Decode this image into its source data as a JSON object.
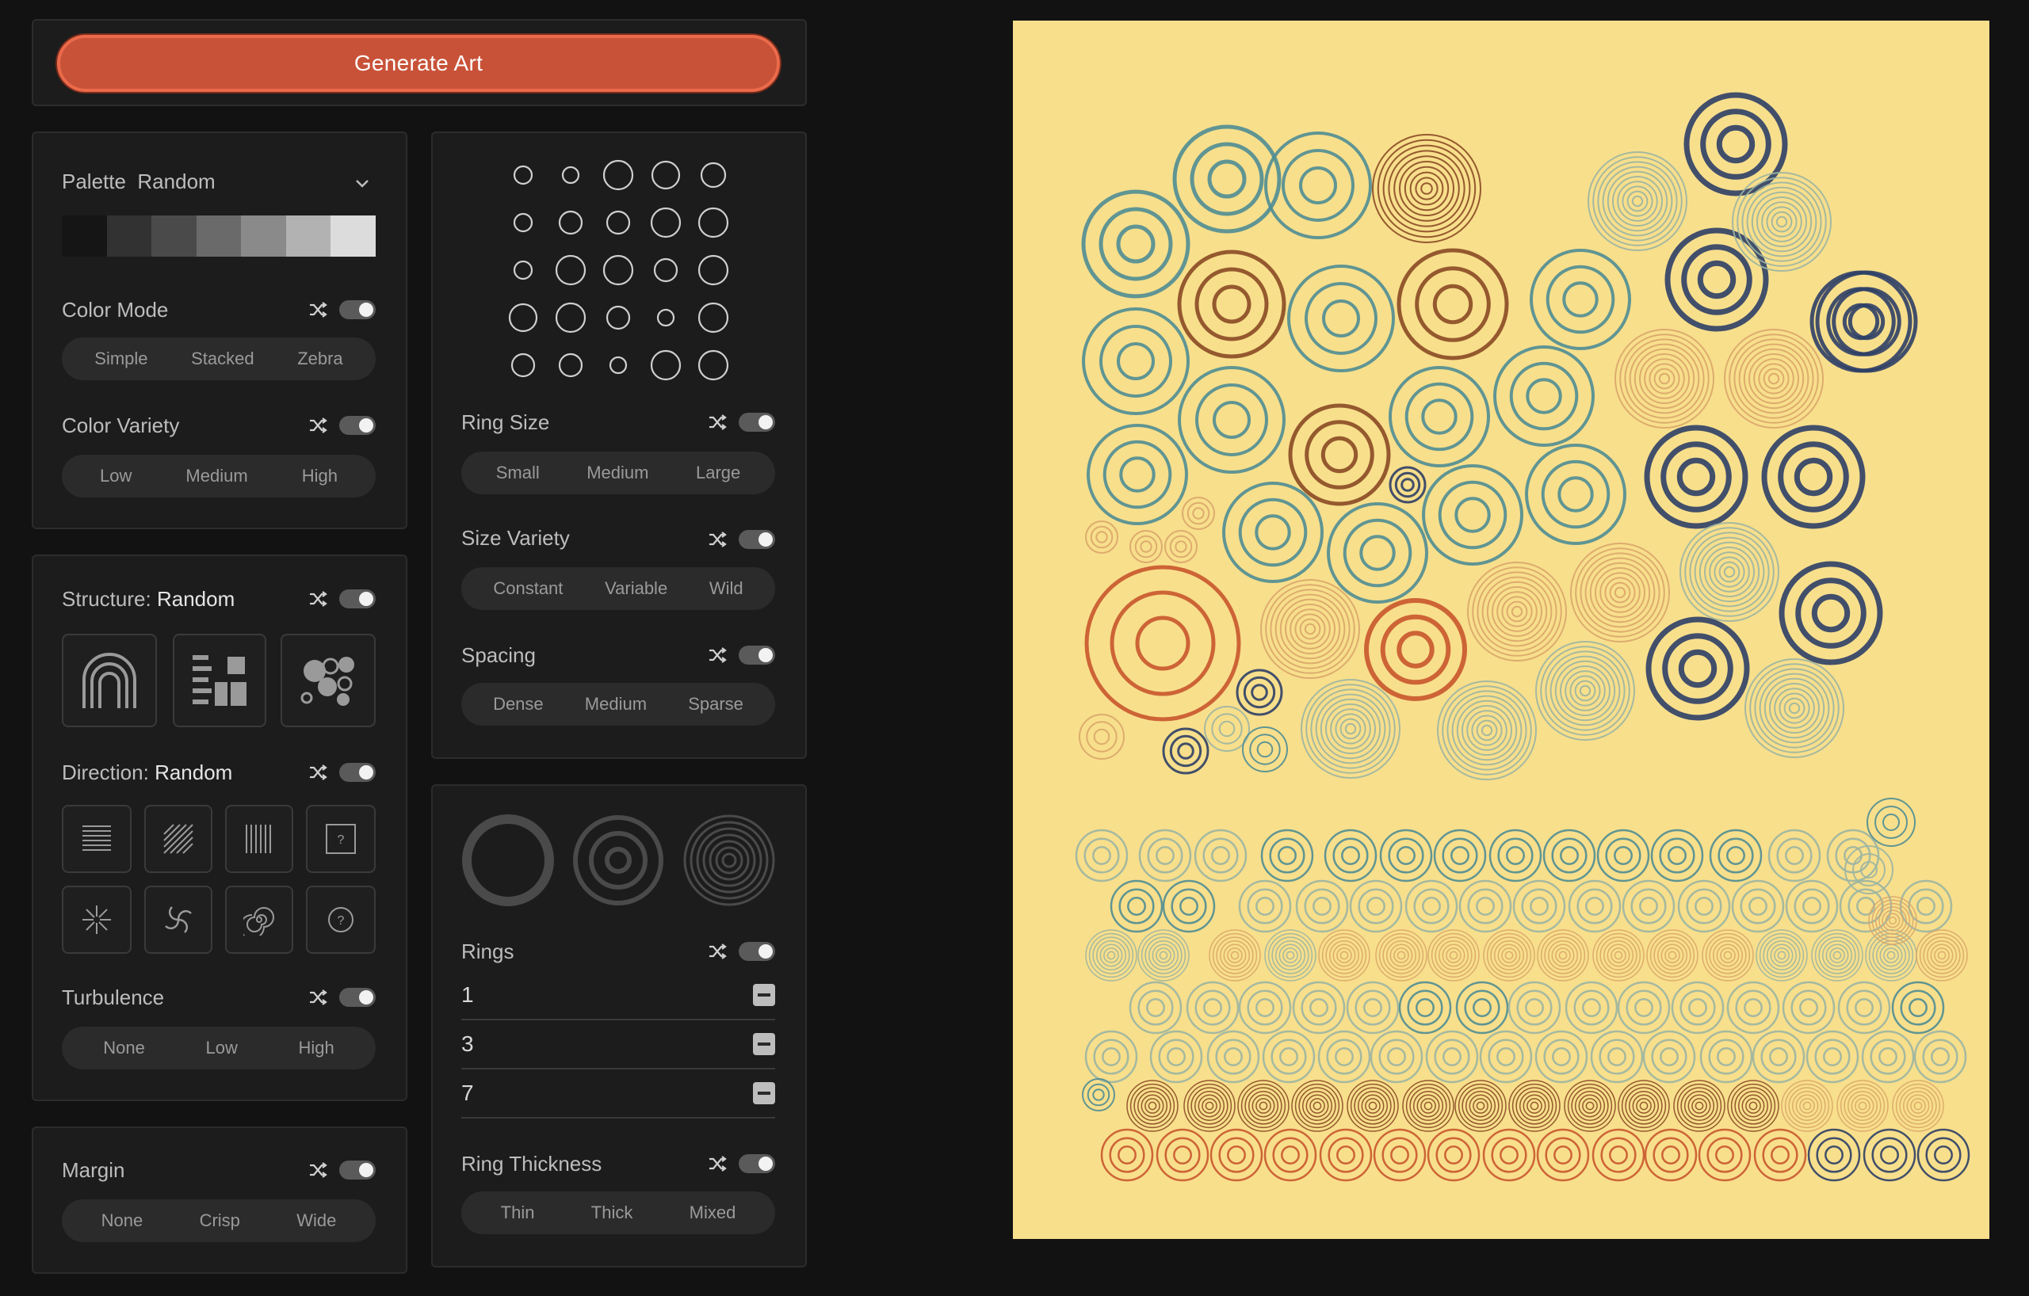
{
  "generate": {
    "label": "Generate Art"
  },
  "palette": {
    "label": "Palette",
    "value": "Random",
    "swatches": [
      "#151515",
      "#323232",
      "#4a4a4a",
      "#6a6a6a",
      "#8a8a8a",
      "#b2b2b2",
      "#dcdcdc"
    ]
  },
  "color_mode": {
    "label": "Color Mode",
    "options": [
      "Simple",
      "Stacked",
      "Zebra"
    ]
  },
  "color_variety": {
    "label": "Color Variety",
    "options": [
      "Low",
      "Medium",
      "High"
    ]
  },
  "structure": {
    "label": "Structure:",
    "value": "Random"
  },
  "direction": {
    "label": "Direction:",
    "value": "Random"
  },
  "turbulence": {
    "label": "Turbulence",
    "options": [
      "None",
      "Low",
      "High"
    ]
  },
  "margin": {
    "label": "Margin",
    "options": [
      "None",
      "Crisp",
      "Wide"
    ]
  },
  "ring_size": {
    "label": "Ring Size",
    "options": [
      "Small",
      "Medium",
      "Large"
    ]
  },
  "size_variety": {
    "label": "Size Variety",
    "options": [
      "Constant",
      "Variable",
      "Wild"
    ]
  },
  "spacing": {
    "label": "Spacing",
    "options": [
      "Dense",
      "Medium",
      "Sparse"
    ]
  },
  "rings": {
    "label": "Rings",
    "values": [
      "1",
      "3",
      "7"
    ]
  },
  "ring_thickness": {
    "label": "Ring Thickness",
    "options": [
      "Thin",
      "Thick",
      "Mixed"
    ]
  },
  "colors": {
    "canvas_bg": "#f8df8c",
    "accent": "#c85238",
    "teal": "#4f8d94",
    "navy": "#2d3f66",
    "rust": "#c8572c",
    "brown": "#8a4a24",
    "sage": "#9bb5a2",
    "sand": "#d9a66a"
  },
  "icons": [
    "shuffle-icon",
    "chevron-down-icon",
    "arch-icon",
    "blocks-icon",
    "circles-cluster-icon",
    "horizontal-lines-icon",
    "diagonal-lines-icon",
    "vertical-lines-icon",
    "question-box-icon",
    "burst-icon",
    "swirl-icon",
    "spiral-icon",
    "question-circle-icon",
    "minus-icon"
  ]
}
